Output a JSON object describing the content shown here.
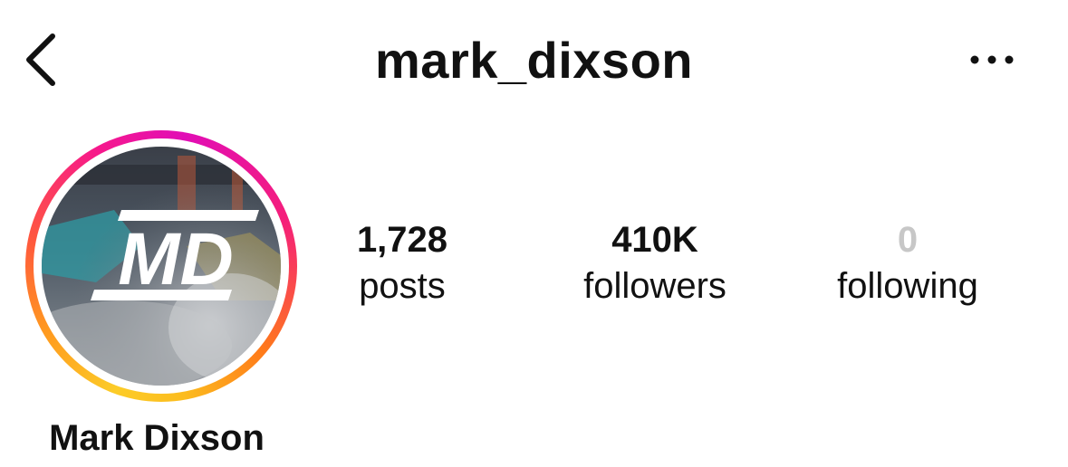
{
  "header": {
    "username": "mark_dixson",
    "back_icon": "chevron-left-icon",
    "more_icon": "more-horizontal-icon"
  },
  "profile": {
    "display_name": "Mark Dixson",
    "avatar_logo_text": "MD",
    "story_ring_colors": [
      "#fccc28",
      "#ff5a3c",
      "#e10db6"
    ]
  },
  "stats": {
    "posts": {
      "value": "1,728",
      "label": "posts"
    },
    "followers": {
      "value": "410K",
      "label": "followers"
    },
    "following": {
      "value": "0",
      "label": "following",
      "value_color": "#c7c7c7"
    }
  }
}
